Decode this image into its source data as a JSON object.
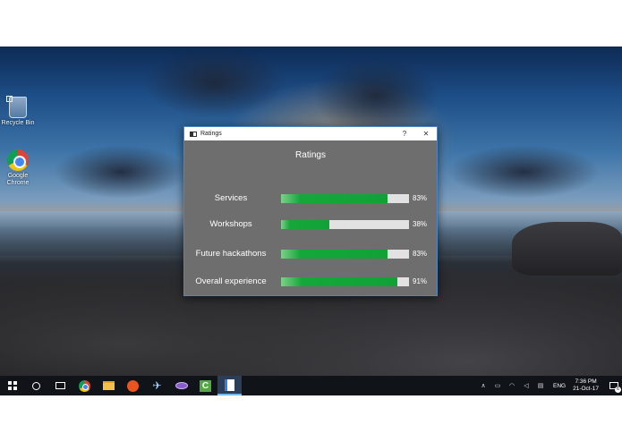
{
  "desktop": {
    "icons": [
      {
        "label": "Recycle Bin",
        "icon": "recycle-bin-icon"
      },
      {
        "label": "Google Chrome",
        "icon": "chrome-icon"
      }
    ]
  },
  "window": {
    "title": "Ratings",
    "help_button": "?",
    "close_button": "✕",
    "heading": "Ratings",
    "ratings": [
      {
        "label": "Services",
        "percent_text": "83%",
        "value": 0.83
      },
      {
        "label": "Workshops",
        "percent_text": "38%",
        "value": 0.38
      },
      {
        "label": "Future hackathons",
        "percent_text": "83%",
        "value": 0.83
      },
      {
        "label": "Overall experience",
        "percent_text": "91%",
        "value": 0.91
      }
    ],
    "bar_color": "#10a236",
    "track_color": "#e2e2e2",
    "background_color": "#6e6e6e"
  },
  "taskbar": {
    "apps": [
      "start-icon",
      "search-icon",
      "task-view-icon",
      "chrome-icon",
      "file-explorer-icon",
      "ubuntu-icon",
      "airplane-app-icon",
      "media-app-icon",
      "camtasia-icon",
      "ratings-app-icon"
    ],
    "tray": {
      "language": "ENG",
      "time": "7:36 PM",
      "date": "21-Oct-17",
      "notification_count": "6"
    }
  }
}
